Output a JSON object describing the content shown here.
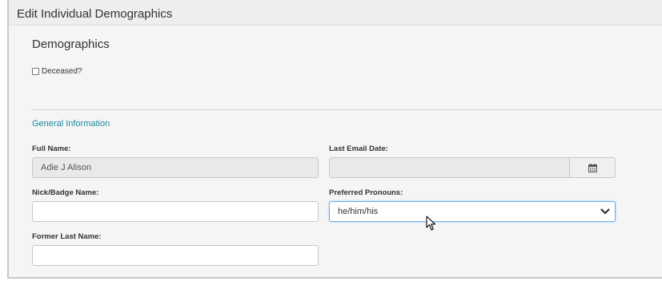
{
  "header": {
    "title": "Edit Individual Demographics"
  },
  "section": {
    "title": "Demographics"
  },
  "deceased": {
    "label": "Deceased?",
    "checked": false
  },
  "general": {
    "title": "General Information"
  },
  "fields": {
    "full_name": {
      "label": "Full Name:",
      "value": "Adie J Alison"
    },
    "last_email_date": {
      "label": "Last Email Date:",
      "value": ""
    },
    "nick_badge_name": {
      "label": "Nick/Badge Name:",
      "value": ""
    },
    "preferred_pronouns": {
      "label": "Preferred Pronouns:",
      "value": "he/him/his"
    },
    "former_last_name": {
      "label": "Former Last Name:",
      "value": ""
    }
  },
  "colors": {
    "accent": "#1a8aa0",
    "focus": "#66afe9"
  },
  "icons": {
    "calendar": "calendar-icon",
    "dropdown": "chevron-down-icon",
    "cursor": "mouse-cursor-icon"
  }
}
